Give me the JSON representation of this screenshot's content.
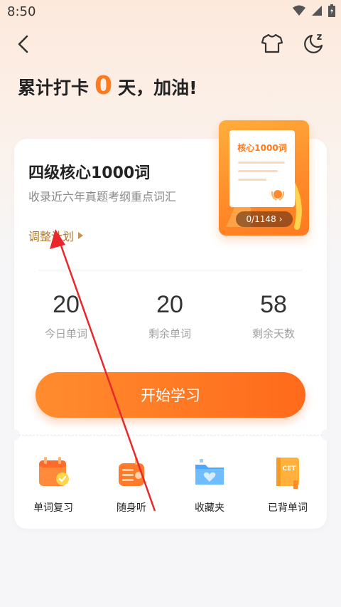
{
  "status": {
    "time": "8:50"
  },
  "streak": {
    "prefix": "累计打卡",
    "days": "0",
    "suffix": "天，加油!"
  },
  "book": {
    "title": "四级核心1000词",
    "description": "收录近六年真题考纲重点词汇",
    "adjust_label": "调整计划",
    "cover_label": "核心1000词",
    "progress": "0/1148"
  },
  "stats": [
    {
      "value": "20",
      "label": "今日单词"
    },
    {
      "value": "20",
      "label": "剩余单词"
    },
    {
      "value": "58",
      "label": "剩余天数"
    }
  ],
  "start_button": "开始学习",
  "tools": [
    {
      "label": "单词复习",
      "icon": "calendar-check-icon"
    },
    {
      "label": "随身听",
      "icon": "radio-icon"
    },
    {
      "label": "收藏夹",
      "icon": "folder-heart-icon"
    },
    {
      "label": "已背单词",
      "icon": "cet-book-icon"
    }
  ],
  "colors": {
    "accent": "#ff7a1a",
    "adjust": "#b07a2e"
  }
}
